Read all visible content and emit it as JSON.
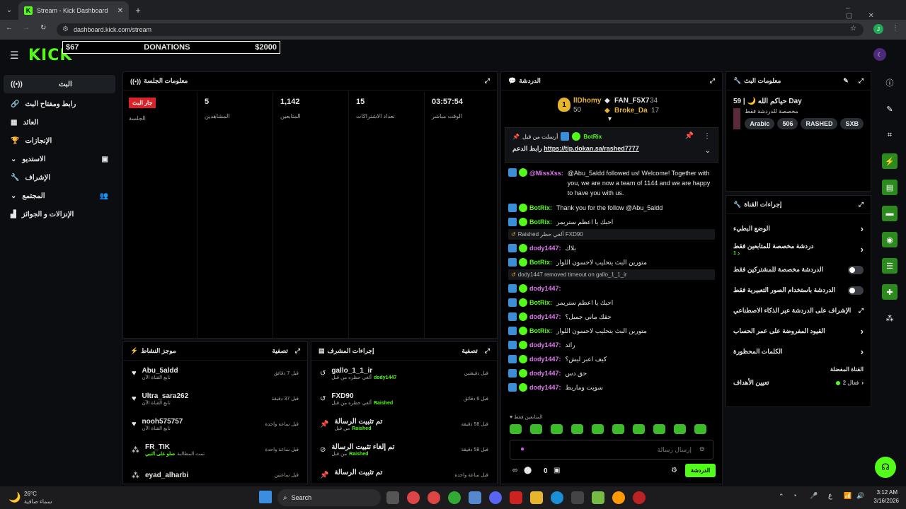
{
  "browser": {
    "tab_title": "Stream - Kick Dashboard",
    "url": "dashboard.kick.com/stream"
  },
  "header": {
    "logo": "KICK",
    "goal_left": "$67",
    "goal_title": "DONATIONS",
    "goal_right": "$2000"
  },
  "sidebar": {
    "items": [
      {
        "label": "البث"
      },
      {
        "label": "رابط ومفتاح البث"
      },
      {
        "label": "العائد"
      },
      {
        "label": "الإنجازات"
      },
      {
        "label": "الاستديو"
      },
      {
        "label": "الإشراف"
      },
      {
        "label": "المجتمع"
      },
      {
        "label": "الإنزالات و الجوائز"
      }
    ]
  },
  "session": {
    "title": "معلومات الجلسة",
    "live_badge": "جار البث",
    "session_label": "الجلسة",
    "viewers_value": "5",
    "viewers_label": "المشاهدين",
    "followers_value": "1,142",
    "followers_label": "المتابعين",
    "subs_value": "15",
    "subs_label": "تعداد الاشتراكات",
    "live_time_value": "03:57:54",
    "live_time_label": "الوقت مباشر"
  },
  "activity": {
    "title": "موجز النشاط",
    "filter": "تصفية",
    "items": [
      {
        "name": "Abu_5aldd",
        "sub": "تابع القناة الآن",
        "time": "قبل 7 دقائق"
      },
      {
        "name": "Ultra_sara262",
        "sub": "تابع القناة الآن",
        "time": "قبل 37 دقيقة"
      },
      {
        "name": "nooh575757",
        "sub": "تابع القناة الآن",
        "time": "قبل ساعة واحدة"
      },
      {
        "name": "FR_TIK",
        "sub": "تمت المطالبة",
        "sub2": "صلو على النبي",
        "time": "قبل ساعة واحدة"
      },
      {
        "name": "eyad_alharbi",
        "sub": "",
        "time": "قبل ساعتين"
      }
    ]
  },
  "modactions": {
    "title": "إجراءات المشرف",
    "filter": "تصفية",
    "items": [
      {
        "name": "gallo_1_1_ir",
        "sub": "ألغي حظره من قبل",
        "by": "dody1447",
        "time": "قبل دقيقتين"
      },
      {
        "name": "FXD90",
        "sub": "ألغي حظره من قبل",
        "by": "Raished",
        "time": "قبل 6 دقائق"
      },
      {
        "name": "تم تثبيت الرسالة",
        "sub": "من قبل",
        "by": "Raished",
        "time": "قبل 58 دقيقة"
      },
      {
        "name": "تم إلغاء تثبيت الرسالة",
        "sub": "من قبل",
        "by": "Raished",
        "time": "قبل 58 دقيقة"
      },
      {
        "name": "تم تثبيت الرسالة",
        "sub": "",
        "by": "",
        "time": "قبل ساعة واحدة"
      }
    ]
  },
  "chat": {
    "title": "الدردشة",
    "top1_name": "llDhomy",
    "top1_value": "50",
    "top2_name": "FAN_F5X7",
    "top2_value": "34",
    "top3_name": "Broke_Da",
    "top3_value": "17",
    "pinned_by": "أرسلت من قبل",
    "pinned_user": "BotRix",
    "pinned_text": "رابط الدعم",
    "pinned_link": "https://tip.dokan.sa/rashed7777",
    "messages": [
      {
        "user": "@MissXss:",
        "text": "@Abu_5aldd followed us! Welcome! Together with you, we are now a team of 1144 and we are happy to have you with us.",
        "color": "pk"
      },
      {
        "user": "BotRix:",
        "text": "Thank you for the follow @Abu_5aldd",
        "color": "g"
      },
      {
        "user": "BotRix:",
        "text": "احبك يا اعظم ستريمر",
        "color": "g"
      },
      {
        "sys": true,
        "text": "Raished ألغي حظر FXD90"
      },
      {
        "user": "dody1447:",
        "text": "بلاك",
        "color": "pk"
      },
      {
        "user": "BotRix:",
        "text": "متورين البث يتحليب لاحسون اللوار",
        "color": "g"
      },
      {
        "sys": true,
        "text": "dody1447 removed timeout on gallo_1_1_ir"
      },
      {
        "user": "dody1447:",
        "text": "",
        "color": "pk"
      },
      {
        "user": "BotRix:",
        "text": "احبك يا اعظم ستريمر",
        "color": "g"
      },
      {
        "user": "dody1447:",
        "text": "حقك ماني جميل؟",
        "color": "pk"
      },
      {
        "user": "BotRix:",
        "text": "متورين البث يتحليب لاحسون اللوار",
        "color": "g"
      },
      {
        "user": "dody1447:",
        "text": "رائد",
        "color": "pk"
      },
      {
        "user": "dody1447:",
        "text": "كيف اعبر ليش؟",
        "color": "pk"
      },
      {
        "user": "dody1447:",
        "text": "حق دس",
        "color": "pk"
      },
      {
        "user": "dody1447:",
        "text": "سويت وماربط",
        "color": "pk"
      }
    ],
    "followers_only": "المتابعين فقط",
    "input_placeholder": "إرسال رسالة",
    "count": "0",
    "send": "الدردشة"
  },
  "streaminfo": {
    "title": "معلومات البث",
    "stream_title": "حياكم الله 🌙 | 59 Day",
    "category": "مخصصة للدردشة فقط",
    "tags": [
      "Arabic",
      "506",
      "RASHED",
      "SXB"
    ]
  },
  "channelactions": {
    "title": "إجراءات القناة",
    "items": [
      {
        "label": "الوضع البطيء",
        "type": "arrow"
      },
      {
        "label": "دردشة مخصصة للمتابعين فقط",
        "sub": "1 د",
        "type": "arrow"
      },
      {
        "label": "الدردشة مخصصة للمشتركين فقط",
        "type": "toggle"
      },
      {
        "label": "الدردشة باستخدام الصور التعبيرية فقط",
        "type": "toggle"
      },
      {
        "label": "الإشراف على الدردشة عبر الذكاء الاصطناعي",
        "type": "ext"
      },
      {
        "label": "القيود المفروضة على عمر الحساب",
        "type": "arrow"
      },
      {
        "label": "الكلمات المحظورة",
        "type": "arrow"
      }
    ],
    "fav_label": "القناة المفضلة",
    "goal_label": "تعيين الأهداف",
    "goal_value": "فعال 2"
  },
  "taskbar": {
    "weather_temp": "26°C",
    "weather_desc": "سماء صافية",
    "search": "Search",
    "time": "3:12 AM",
    "date": "3/16/2026",
    "lang": "ع"
  },
  "colors": {
    "accent": "#53fc18",
    "panel": "#000000"
  }
}
